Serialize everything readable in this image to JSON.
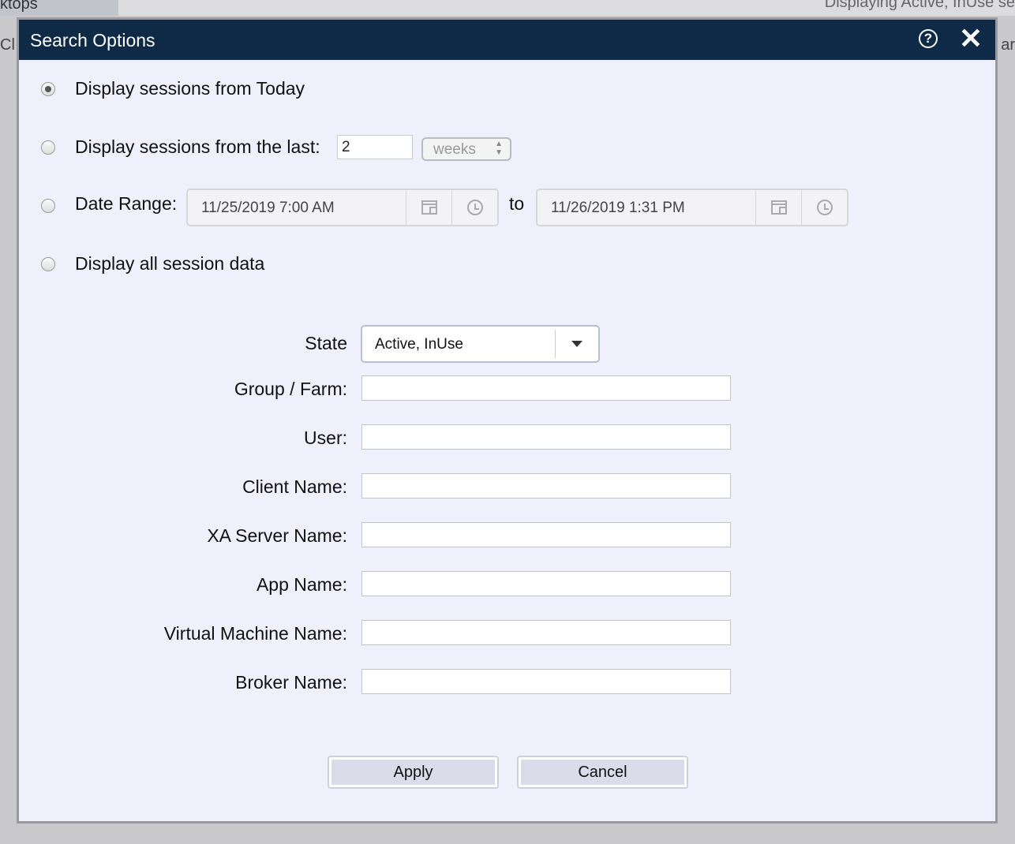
{
  "background": {
    "tab_label": "ktops",
    "status_text": "Displaying Active, InUse se",
    "left_fragment": "Cl",
    "right_fragment": "ar"
  },
  "dialog": {
    "title": "Search Options",
    "help_icon": "help-circle-icon",
    "close_icon": "close-icon",
    "help_glyph": "?",
    "close_glyph": "✕"
  },
  "options": {
    "selected": "today",
    "today_label": "Display sessions from Today",
    "last_label": "Display sessions from the last:",
    "last_value": "2",
    "last_unit": "weeks",
    "range_label": "Date Range:",
    "range_from": "11/25/2019 7:00 AM",
    "range_to_label": "to",
    "range_to": "11/26/2019 1:31 PM",
    "all_label": "Display all session data"
  },
  "filters": {
    "state_label": "State",
    "state_value": "Active, InUse",
    "group_farm_label": "Group / Farm:",
    "user_label": "User:",
    "client_name_label": "Client Name:",
    "xa_server_label": "XA Server Name:",
    "app_name_label": "App Name:",
    "vm_name_label": "Virtual Machine Name:",
    "broker_name_label": "Broker Name:",
    "group_farm_value": "",
    "user_value": "",
    "client_name_value": "",
    "xa_server_value": "",
    "app_name_value": "",
    "vm_name_value": "",
    "broker_name_value": ""
  },
  "buttons": {
    "apply": "Apply",
    "cancel": "Cancel"
  },
  "colors": {
    "titlebar": "#0f2a47",
    "dialog_bg": "#f0effc",
    "button_face": "#dcdbea"
  }
}
